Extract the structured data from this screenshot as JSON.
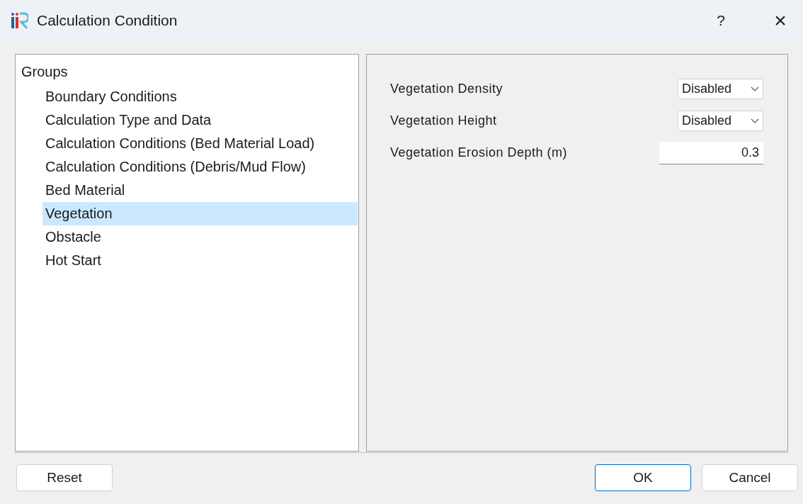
{
  "window": {
    "title": "Calculation Condition",
    "help": "?",
    "close": "×"
  },
  "tree": {
    "label": "Groups",
    "children": [
      {
        "label": "Boundary Conditions",
        "selected": false
      },
      {
        "label": "Calculation Type and Data",
        "selected": false
      },
      {
        "label": "Calculation Conditions (Bed Material Load)",
        "selected": false
      },
      {
        "label": "Calculation Conditions (Debris/Mud Flow)",
        "selected": false
      },
      {
        "label": "Bed Material",
        "selected": false
      },
      {
        "label": "Vegetation",
        "selected": true
      },
      {
        "label": "Obstacle",
        "selected": false
      },
      {
        "label": "Hot Start",
        "selected": false
      }
    ]
  },
  "fields": [
    {
      "kind": "select",
      "label": "Vegetation Density",
      "value": "Disabled"
    },
    {
      "kind": "select",
      "label": "Vegetation Height",
      "value": "Disabled"
    },
    {
      "kind": "number",
      "label": "Vegetation Erosion Depth (m)",
      "value": "0.3"
    }
  ],
  "buttons": {
    "left": [
      {
        "label": "Reset",
        "default": false
      }
    ],
    "right": [
      {
        "label": "OK",
        "default": true
      },
      {
        "label": "Cancel",
        "default": false
      }
    ]
  }
}
